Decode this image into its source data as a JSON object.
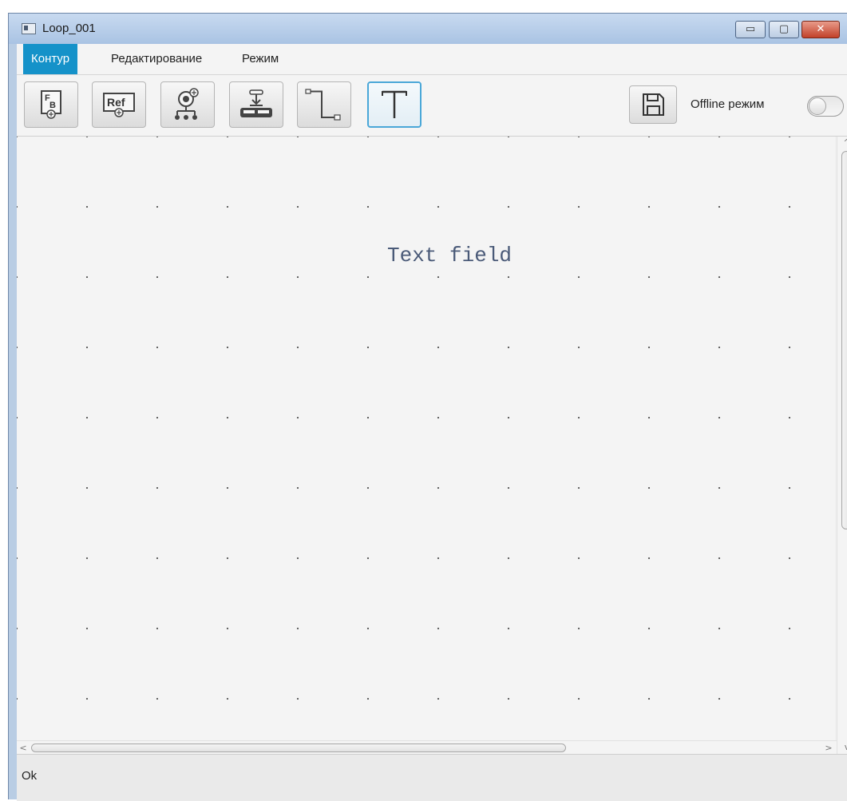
{
  "window": {
    "title": "Loop_001",
    "controls": {
      "minimize": "▭",
      "maximize": "▢",
      "close": "✕"
    }
  },
  "menubar": {
    "items": [
      {
        "label": "Контур",
        "active": true
      },
      {
        "label": "Редактирование",
        "active": false
      },
      {
        "label": "Режим",
        "active": false
      }
    ]
  },
  "toolbar": {
    "buttons": [
      {
        "icon": "fb-icon",
        "selected": false
      },
      {
        "icon": "ref-icon",
        "selected": false
      },
      {
        "icon": "node-network-icon",
        "selected": false
      },
      {
        "icon": "download-device-icon",
        "selected": false
      },
      {
        "icon": "connector-line-icon",
        "selected": false
      },
      {
        "icon": "text-tool-icon",
        "selected": true
      }
    ],
    "save_icon": "save-icon",
    "offline_label": "Offline режим",
    "offline_enabled": false
  },
  "canvas": {
    "text_field": "Text field"
  },
  "scrollbars": {
    "up": "^",
    "down": "v",
    "left": "<",
    "right": ">"
  },
  "status": {
    "text": "Ok"
  },
  "colors": {
    "menu_active": "#1592c9",
    "selected_border": "#4aa7d8",
    "canvas_text": "#4a5a78"
  }
}
